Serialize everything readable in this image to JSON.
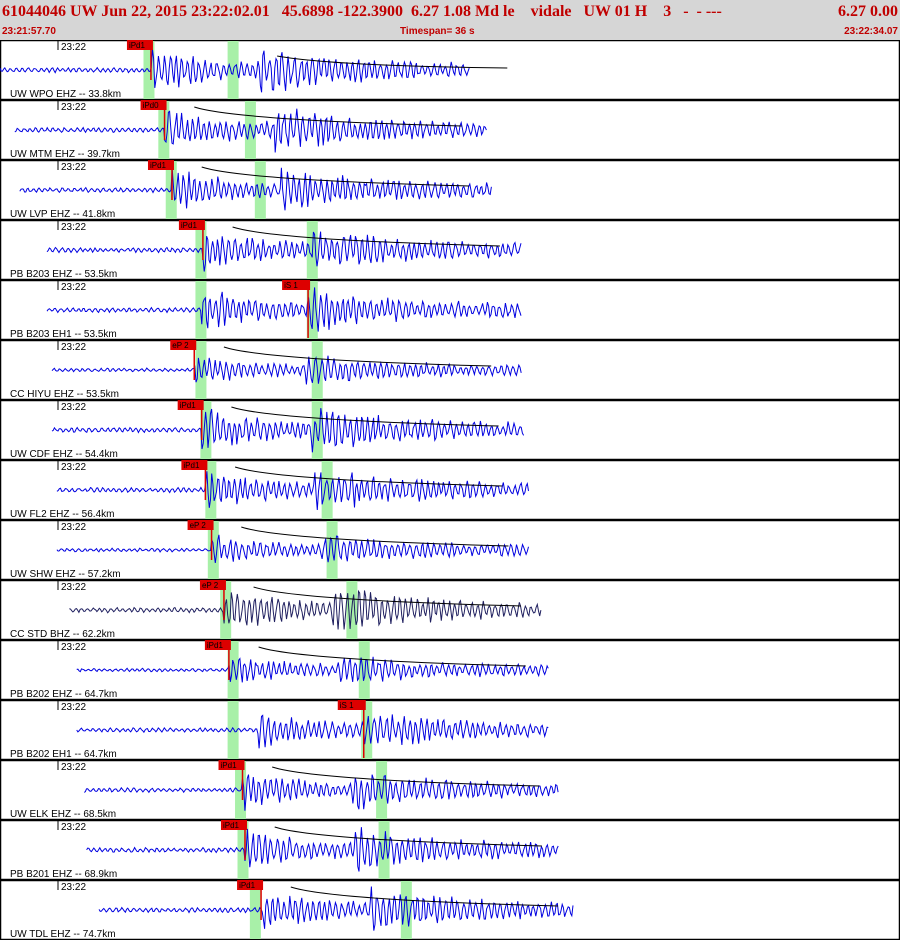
{
  "header": {
    "event_line": "61044046 UW Jun 22, 2015 23:22:02.01   45.6898 -122.3900  6.27 1.08 Md le    vidale   UW 01 H    3   -  - ---",
    "right_value": "6.27 0.00",
    "start_time": "23:21:57.70",
    "timespan": "Timespan=  36 s",
    "end_time": "23:22:34.07"
  },
  "colors": {
    "header_bg": "#d6d6d6",
    "header_text": "#c00000",
    "trace": "#0000e0",
    "trace_dark": "#202060",
    "pick": "#dd0000",
    "window": "#a8f0a8",
    "curve": "#000000"
  },
  "traces": [
    {
      "time_label": "23:22",
      "station": "UW WPO  EHZ -- 33.8km",
      "pick": "iPd1",
      "pick_t": 6.1,
      "s_pick": "",
      "s_t": null,
      "green": [
        6.0,
        9.4
      ],
      "start": 0.0,
      "end": 19.0,
      "amp": 0.85,
      "dark": false
    },
    {
      "time_label": "23:22",
      "station": "UW MTM  EHZ -- 39.7km",
      "pick": "iPd0",
      "pick_t": 6.65,
      "s_pick": "",
      "s_t": null,
      "green": [
        6.6,
        10.1
      ],
      "start": 0.6,
      "end": 19.7,
      "amp": 0.85,
      "dark": false
    },
    {
      "time_label": "23:22",
      "station": "UW LVP  EHZ -- 41.8km",
      "pick": "iPd1",
      "pick_t": 6.95,
      "s_pick": "",
      "s_t": null,
      "green": [
        6.9,
        10.5
      ],
      "start": 0.8,
      "end": 19.9,
      "amp": 0.8,
      "dark": false
    },
    {
      "time_label": "23:22",
      "station": "PB B203 EHZ -- 53.5km",
      "pick": "iPd1",
      "pick_t": 8.2,
      "s_pick": "",
      "s_t": null,
      "green": [
        8.1,
        12.6
      ],
      "start": 1.9,
      "end": 21.1,
      "amp": 0.8,
      "dark": false
    },
    {
      "time_label": "23:22",
      "station": "PB B203 EH1 -- 53.5km",
      "pick": "",
      "pick_t": null,
      "s_pick": "iS 1",
      "s_t": 12.45,
      "green": [
        8.1,
        12.6
      ],
      "start": 1.9,
      "end": 21.1,
      "amp": 0.8,
      "dark": false
    },
    {
      "time_label": "23:22",
      "station": "CC HIYU EHZ -- 53.5km",
      "pick": "eP 2",
      "pick_t": 7.85,
      "s_pick": "",
      "s_t": null,
      "green": [
        8.1,
        12.8
      ],
      "start": 2.1,
      "end": 21.1,
      "amp": 0.6,
      "dark": false
    },
    {
      "time_label": "23:22",
      "station": "UW CDF  EHZ -- 54.4km",
      "pick": "iPd1",
      "pick_t": 8.15,
      "s_pick": "",
      "s_t": null,
      "green": [
        8.3,
        12.8
      ],
      "start": 2.1,
      "end": 21.2,
      "amp": 0.85,
      "dark": false
    },
    {
      "time_label": "23:22",
      "station": "UW FL2  EHZ -- 56.4km",
      "pick": "iPd1",
      "pick_t": 8.3,
      "s_pick": "",
      "s_t": null,
      "green": [
        8.5,
        13.2
      ],
      "start": 2.3,
      "end": 21.4,
      "amp": 0.8,
      "dark": false
    },
    {
      "time_label": "23:22",
      "station": "UW SHW  EHZ -- 57.2km",
      "pick": "eP 2",
      "pick_t": 8.55,
      "s_pick": "",
      "s_t": null,
      "green": [
        8.6,
        13.4
      ],
      "start": 2.3,
      "end": 21.4,
      "amp": 0.6,
      "dark": false
    },
    {
      "time_label": "23:22",
      "station": "CC STD  BHZ -- 62.2km",
      "pick": "eP 2",
      "pick_t": 9.05,
      "s_pick": "",
      "s_t": null,
      "green": [
        9.1,
        14.2
      ],
      "start": 2.8,
      "end": 21.9,
      "amp": 0.85,
      "dark": true
    },
    {
      "time_label": "23:22",
      "station": "PB B202 EHZ -- 64.7km",
      "pick": "iPd1",
      "pick_t": 9.25,
      "s_pick": "",
      "s_t": null,
      "green": [
        9.4,
        14.7
      ],
      "start": 3.1,
      "end": 22.2,
      "amp": 0.6,
      "dark": false
    },
    {
      "time_label": "23:22",
      "station": "PB B202 EH1 -- 64.7km",
      "pick": "",
      "pick_t": null,
      "s_pick": "iS 1",
      "s_t": 14.7,
      "green": [
        9.4,
        14.8
      ],
      "start": 3.1,
      "end": 22.2,
      "amp": 0.7,
      "dark": false
    },
    {
      "time_label": "23:22",
      "station": "UW ELK  EHZ -- 68.5km",
      "pick": "iPd1",
      "pick_t": 9.8,
      "s_pick": "",
      "s_t": null,
      "green": [
        9.7,
        15.4
      ],
      "start": 3.4,
      "end": 22.6,
      "amp": 0.75,
      "dark": false
    },
    {
      "time_label": "23:22",
      "station": "PB B201 EHZ -- 68.9km",
      "pick": "iPd1",
      "pick_t": 9.9,
      "s_pick": "",
      "s_t": null,
      "green": [
        9.8,
        15.5
      ],
      "start": 3.5,
      "end": 22.6,
      "amp": 0.8,
      "dark": false
    },
    {
      "time_label": "23:22",
      "station": "UW TDL  EHZ -- 74.7km",
      "pick": "iPd1",
      "pick_t": 10.55,
      "s_pick": "",
      "s_t": null,
      "green": [
        10.3,
        16.4
      ],
      "start": 4.0,
      "end": 23.2,
      "amp": 0.85,
      "dark": false
    }
  ]
}
